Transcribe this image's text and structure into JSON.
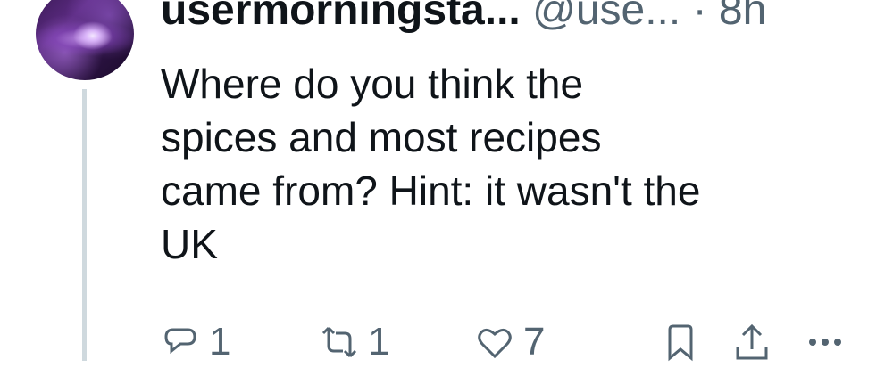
{
  "tweet": {
    "display_name": "usermorningsta...",
    "handle": "@use...",
    "separator": "·",
    "time": "8h",
    "text_lines": [
      "Where do you think the",
      "spices and most recipes",
      "came from? Hint: it wasn't the",
      "UK"
    ]
  },
  "actions": {
    "reply_count": "1",
    "retweet_count": "1",
    "like_count": "7"
  },
  "icons": {
    "avatar": "galaxy-avatar",
    "reply": "reply-icon",
    "retweet": "retweet-icon",
    "like": "heart-icon",
    "bookmark": "bookmark-icon",
    "share": "share-icon",
    "more": "more-icon"
  },
  "colors": {
    "text_primary": "#0f1419",
    "text_secondary": "#536471",
    "thread_line": "#cfd9de",
    "background": "#ffffff"
  }
}
